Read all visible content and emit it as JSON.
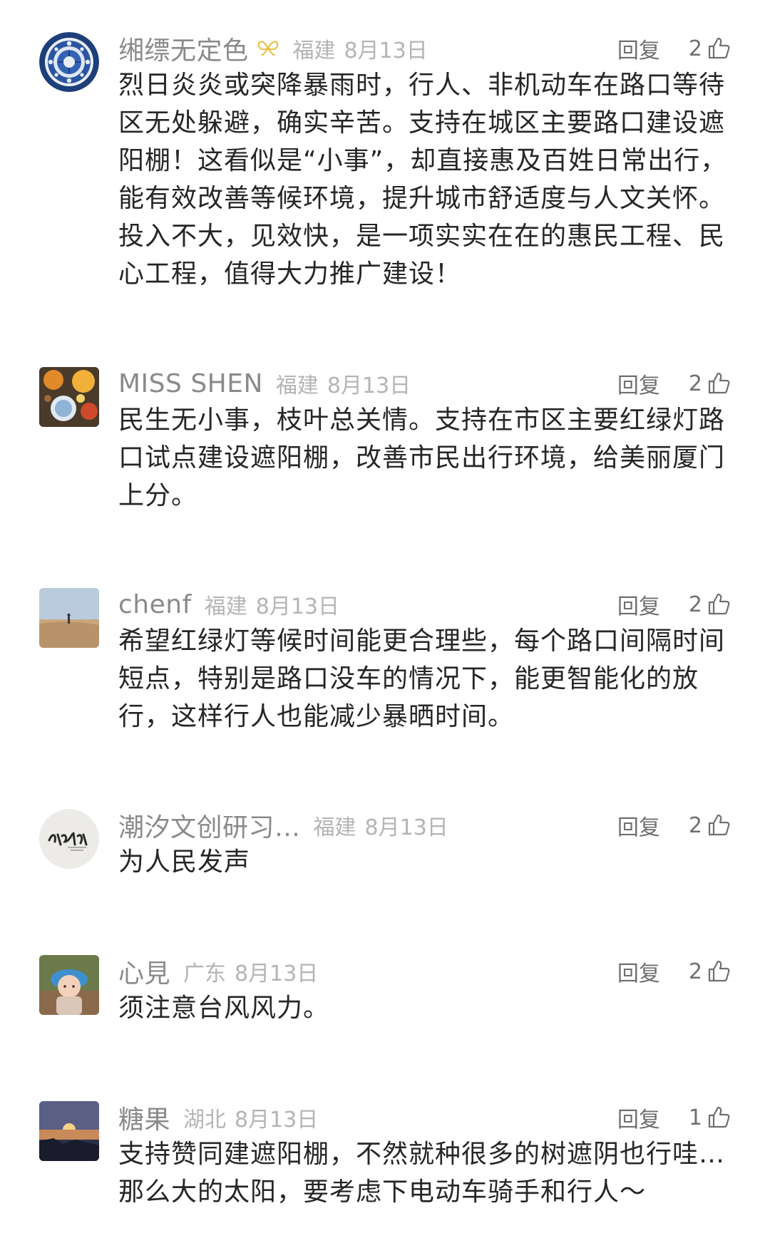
{
  "comments": [
    {
      "username": "缃缥无定色",
      "location": "福建",
      "date": "8月13日",
      "reply_label": "回复",
      "likes": "2",
      "text": "烈日炎炎或突降暴雨时，行人、非机动车在路口等待区无处躲避，确实辛苦。支持在城区主要路口建设遮阳棚！这看似是“小事”，却直接惠及百姓日常出行，能有效改善等候环境，提升城市舒适度与人文关怀。投入不大，见效快，是一项实实在在的惠民工程、民心工程，值得大力推广建设！",
      "avatar_icon": "blue-porcelain-pattern",
      "badge_icon": "butterfly-badge-icon"
    },
    {
      "username": "MISS SHEN",
      "location": "福建",
      "date": "8月13日",
      "reply_label": "回复",
      "likes": "2",
      "text": "民生无小事，枝叶总关情。支持在市区主要红绿灯路口试点建设遮阳棚，改善市民出行环境，给美丽厦门上分。",
      "avatar_icon": "food-photo"
    },
    {
      "username": "chenf",
      "location": "福建",
      "date": "8月13日",
      "reply_label": "回复",
      "likes": "2",
      "text": "希望红绿灯等候时间能更合理些，每个路口间隔时间短点，特别是路口没车的情况下，能更智能化的放行，这样行人也能减少暴晒时间。",
      "avatar_icon": "beach-photo"
    },
    {
      "username": "潮汐文创研习…",
      "location": "福建",
      "date": "8月13日",
      "reply_label": "回复",
      "likes": "2",
      "text": "为人民发声",
      "avatar_icon": "calligraphy-logo"
    },
    {
      "username": "心見",
      "location": "广东",
      "date": "8月13日",
      "reply_label": "回复",
      "likes": "2",
      "text": "须注意台风风力。",
      "avatar_icon": "child-portrait"
    },
    {
      "username": "糖果",
      "location": "湖北",
      "date": "8月13日",
      "reply_label": "回复",
      "likes": "1",
      "text": "支持赞同建遮阳棚，不然就种很多的树遮阴也行哇…那么大的太阳，要考虑下电动车骑手和行人～",
      "avatar_icon": "sunset-photo"
    }
  ],
  "colors": {
    "username": "#8a8a8a",
    "meta": "#b4b4b4",
    "body": "#262626",
    "badge": "#e8c24a"
  }
}
